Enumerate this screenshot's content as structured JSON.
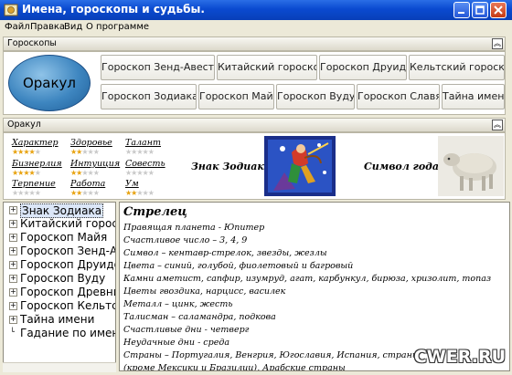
{
  "window": {
    "title": "Имена, гороскопы и судьбы."
  },
  "menu": [
    "Файл",
    "Правка",
    "Вид",
    "О программе"
  ],
  "top_panel": {
    "header": "Гороскопы",
    "oracle_label": "Оракул",
    "buttons_row1": [
      "Гороскоп Зенд-Авесты",
      "Китайский гороскоп",
      "Гороскоп Друидов",
      "Кельтский гороскоп"
    ],
    "buttons_row2": [
      "Гороскоп Зодиака",
      "Гороскоп Майя",
      "Гороскоп Вуду",
      "Гороскоп Славян",
      "Тайна имени"
    ]
  },
  "oracle_panel": {
    "header": "Оракул",
    "attributes": [
      {
        "label": "Характер",
        "stars": 4
      },
      {
        "label": "Здоровье",
        "stars": 2
      },
      {
        "label": "Талант",
        "stars": 0
      },
      {
        "label": "Бизнерлия",
        "stars": 4
      },
      {
        "label": "Интуиция",
        "stars": 2
      },
      {
        "label": "Совесть",
        "stars": 0
      },
      {
        "label": "Терпение",
        "stars": 0
      },
      {
        "label": "Работа",
        "stars": 2
      },
      {
        "label": "Ум",
        "stars": 2
      }
    ],
    "zodiac_caption": "Знак Зодиака",
    "year_caption": "Символ года",
    "star_colors": {
      "on": "#e8a20e",
      "off": "#c9c9c9"
    }
  },
  "tree": {
    "items": [
      {
        "label": "Знак Зодиака",
        "selected": true
      },
      {
        "label": "Китайский гороско"
      },
      {
        "label": "Гороскоп Майя"
      },
      {
        "label": "Гороскоп Зенд-Ав"
      },
      {
        "label": "Гороскоп Друидов"
      },
      {
        "label": "Гороскоп Вуду"
      },
      {
        "label": "Гороскоп Древни"
      },
      {
        "label": "Гороскоп Кельтск"
      },
      {
        "label": "Тайна имени"
      },
      {
        "label": "Гадание по имен",
        "leaf": true
      }
    ]
  },
  "content": {
    "heading": "Стрелец",
    "lines": [
      "Правящая планета - Юпитер",
      "Счастливое число – 3, 4, 9",
      "Символ – кентавр-стрелок, звезды, жезлы",
      "Цвета – синий, голубой, фиолетовый и багровый",
      "Камни аметист, сапфир, изумруд, агат, карбункул, бирюза, хризолит, топаз",
      "Цветы гвоздика, нарцисс, василек",
      "Металл – цинк, жесть",
      "Талисман – саламандра, подкова",
      "Счастливые дни - четверг",
      "Неудачные дни - среда",
      "Страны – Португалия, Венгрия, Югославия, Испания, страны",
      "(кроме Мексики и Бразилии), Арабские страны"
    ]
  },
  "watermark": "CWER.RU",
  "colors": {
    "titlebar": "#0a4ad0",
    "oracle_ellipse": "#3e86c0",
    "selection": "#dbe6f7"
  }
}
